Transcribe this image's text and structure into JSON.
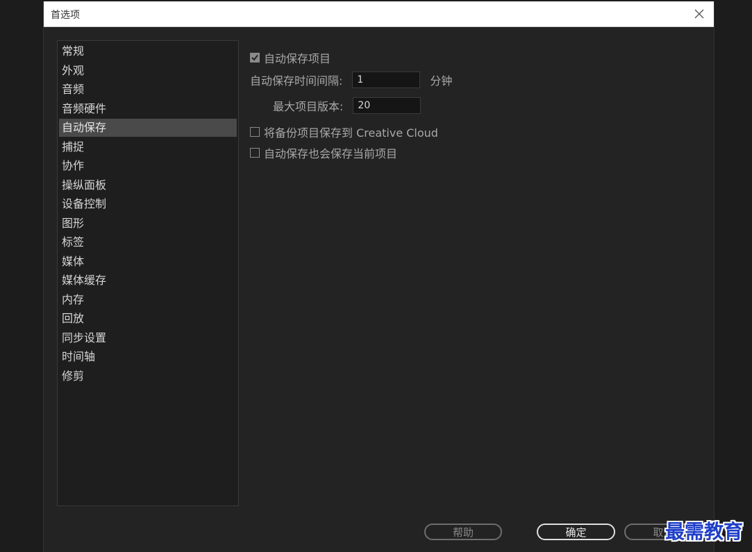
{
  "dialog": {
    "title": "首选项",
    "close_icon": "close-icon"
  },
  "sidebar": {
    "items": [
      {
        "label": "常规"
      },
      {
        "label": "外观"
      },
      {
        "label": "音频"
      },
      {
        "label": "音频硬件"
      },
      {
        "label": "自动保存",
        "selected": true
      },
      {
        "label": "捕捉"
      },
      {
        "label": "协作"
      },
      {
        "label": "操纵面板"
      },
      {
        "label": "设备控制"
      },
      {
        "label": "图形"
      },
      {
        "label": "标签"
      },
      {
        "label": "媒体"
      },
      {
        "label": "媒体缓存"
      },
      {
        "label": "内存"
      },
      {
        "label": "回放"
      },
      {
        "label": "同步设置"
      },
      {
        "label": "时间轴"
      },
      {
        "label": "修剪"
      }
    ]
  },
  "autosave": {
    "autosave_projects": {
      "label": "自动保存项目",
      "checked": true
    },
    "interval": {
      "label": "自动保存时间间隔:",
      "value": "1",
      "unit": "分钟"
    },
    "max_versions": {
      "label": "最大项目版本:",
      "value": "20"
    },
    "backup_to_cloud": {
      "label": "将备份项目保存到 Creative Cloud",
      "checked": false
    },
    "save_current": {
      "label": "自动保存也会保存当前项目",
      "checked": false
    }
  },
  "buttons": {
    "help": "帮助",
    "ok": "确定",
    "cancel": "取消"
  },
  "watermark": "最需教育",
  "colors": {
    "background": "#1c1c1c",
    "panel": "#232323",
    "selected": "#4a4a4a",
    "watermark": "#1f3fc8"
  }
}
